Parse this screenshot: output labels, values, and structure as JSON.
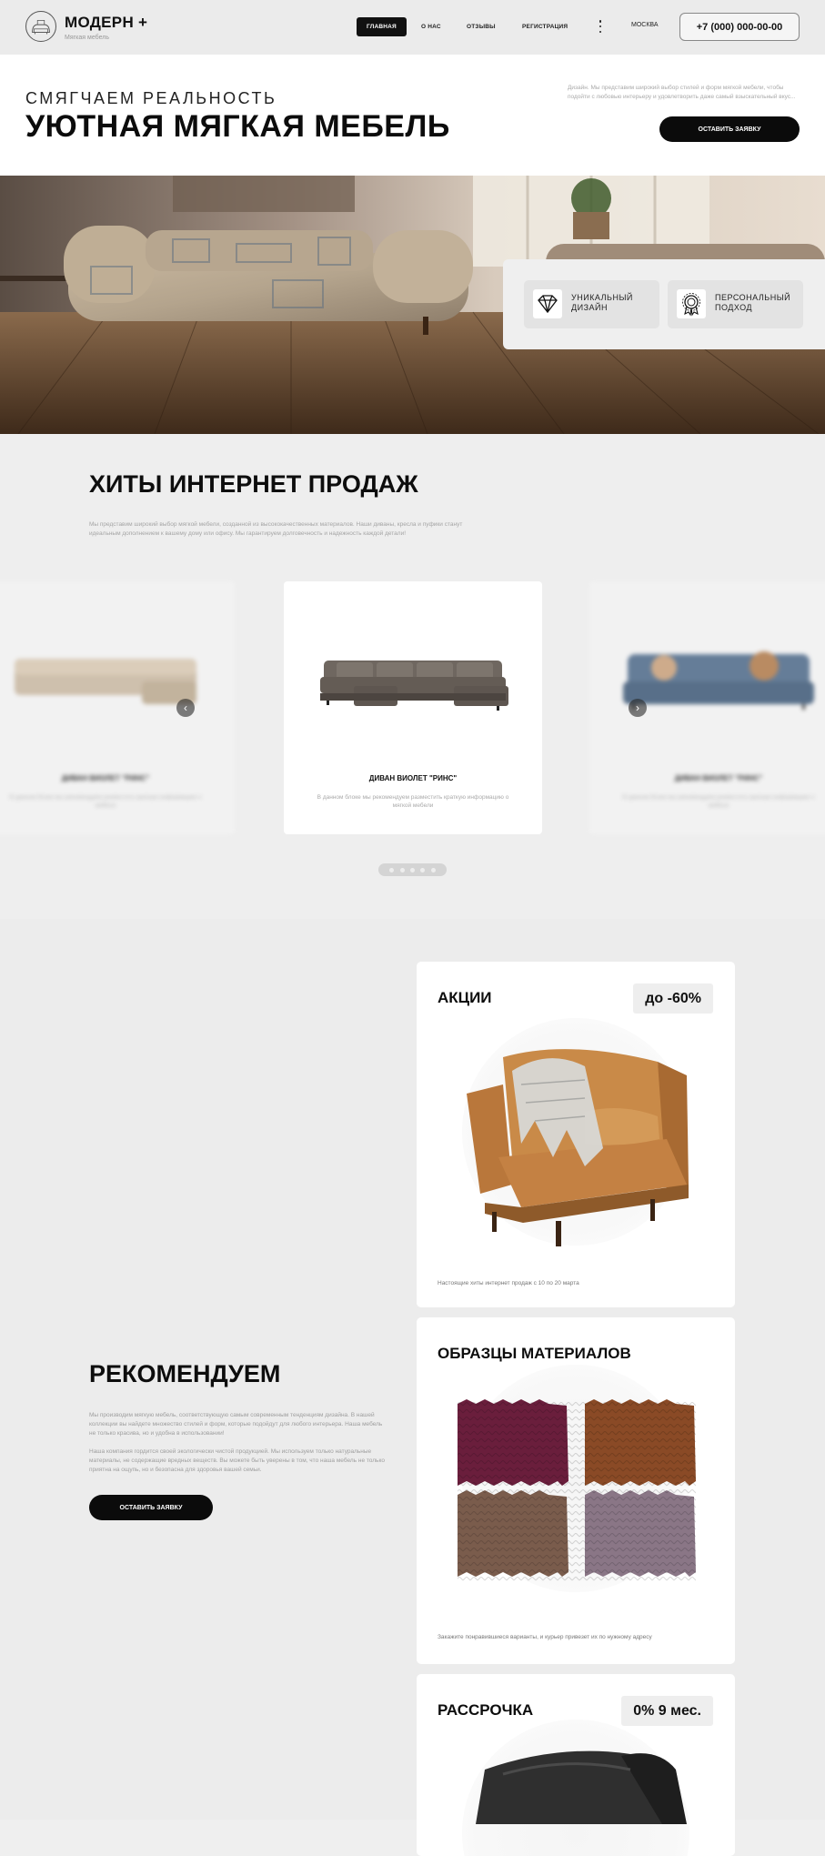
{
  "header": {
    "brand": "МОДЕРН +",
    "brand_sub": "Мягкая мебель",
    "nav": [
      "ГЛАВНАЯ",
      "О НАС",
      "ОТЗЫВЫ",
      "РЕГИСТРАЦИЯ"
    ],
    "city": "МОСКВА",
    "phone": "+7 (000) 000-00-00"
  },
  "hero": {
    "subtitle": "СМЯГЧАЕМ РЕАЛЬНОСТЬ",
    "title": "УЮТНАЯ МЯГКАЯ МЕБЕЛЬ",
    "description": "Дизайн. Мы представим широкий выбор стилей и форм мягкой мебели, чтобы подойти с любовью интерьеру и удовлетворить даже самый взыскательный вкус...",
    "cta": "ОСТАВИТЬ ЗАЯВКУ",
    "features": [
      {
        "icon": "diamond-icon",
        "label": "УНИКАЛЬНЫЙ ДИЗАЙН"
      },
      {
        "icon": "award-icon",
        "label": "ПЕРСОНАЛЬНЫЙ ПОДХОД"
      }
    ]
  },
  "hits": {
    "title": "ХИТЫ ИНТЕРНЕТ ПРОДАЖ",
    "description": "Мы представим широкий выбор мягкой мебели, созданной из высококачественных материалов. Наши диваны, кресла и пуфики станут идеальным дополнением к вашему дому или офису. Мы гарантируем долговечность и надежность каждой детали!",
    "cards": [
      {
        "name": "ДИВАН ВИОЛЕТ \"РИНС\"",
        "desc": "В данном блоке мы рекомендуем разместить краткую информацию о мебели"
      },
      {
        "name": "ДИВАН ВИОЛЕТ \"РИНС\"",
        "desc": "В данном блоке мы рекомендуем разместить краткую информацию о мягкой мебели"
      },
      {
        "name": "ДИВАН ВИОЛЕТ \"РИНС\"",
        "desc": "В данном блоке мы рекомендуем разместить краткую информацию о мебели"
      }
    ],
    "slides_count": 5
  },
  "recommend": {
    "title": "РЕКОМЕНДУЕМ",
    "p1": "Мы производим мягкую мебель, соответствующую самым современным тенденциям дизайна. В нашей коллекции вы найдете множество стилей и форм, которые подойдут для любого интерьера. Наша мебель не только красива, но и удобна в использовании!",
    "p2": "Наша компания гордится своей экологически чистой продукцией. Мы используем только натуральные материалы, не содержащие вредных веществ. Вы можете быть уверены в том, что наша мебель не только приятна на ощупь, но и безопасна для здоровья вашей семьи.",
    "cta": "ОСТАВИТЬ ЗАЯВКУ",
    "cards": [
      {
        "title": "АКЦИИ",
        "badge": "до -60%",
        "caption": "Настоящие хиты интернет продаж с 10 по 20 марта"
      },
      {
        "title": "ОБРАЗЦЫ МАТЕРИАЛОВ",
        "badge": "",
        "caption": "Закажите понравившиеся варианты, и курьер привезет их по нужному адресу"
      },
      {
        "title": "РАССРОЧКА",
        "badge": "0% 9 мес.",
        "caption": ""
      }
    ],
    "swatch_colors": [
      "#6a1e3c",
      "#8a4a26",
      "#7a5c4c",
      "#8a7686"
    ]
  }
}
